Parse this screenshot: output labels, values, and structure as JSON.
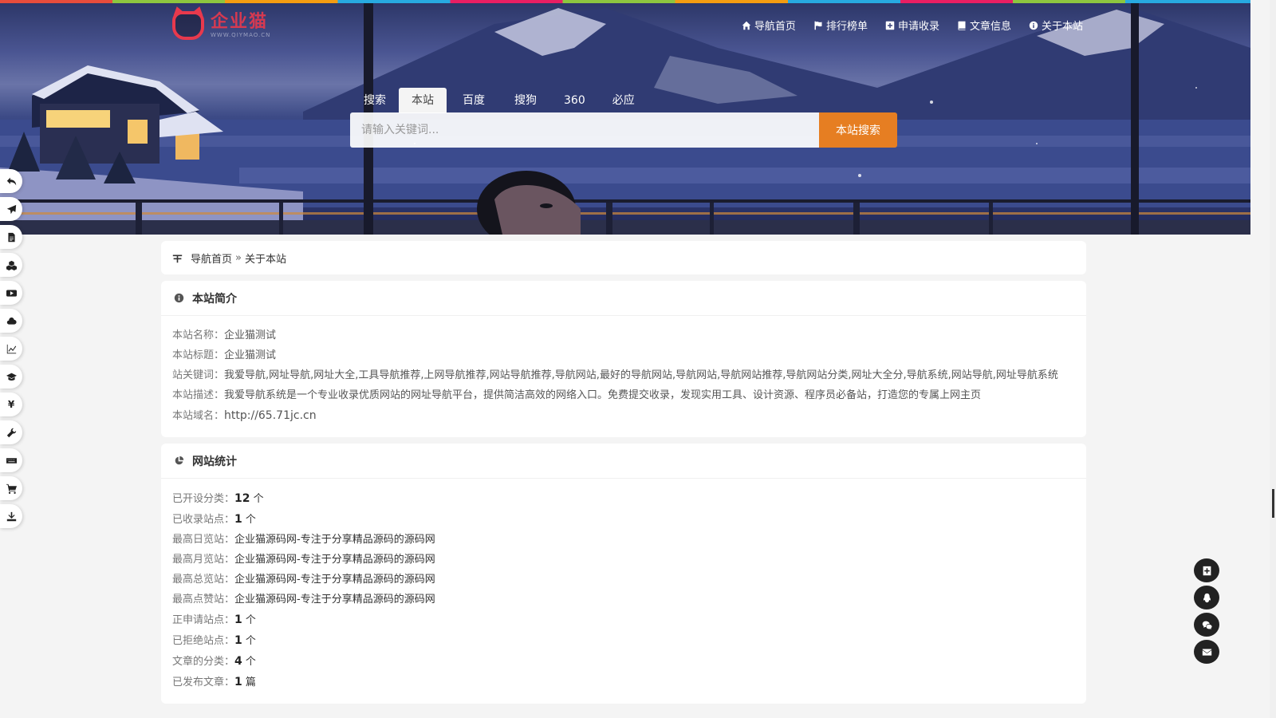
{
  "brand": {
    "logo_title": "企业猫",
    "logo_sub": "WWW.QIYMAO.CN"
  },
  "colors": {
    "accent": "#e67e22",
    "brand": "#e8394d"
  },
  "topnav": [
    {
      "icon": "home-icon",
      "label": "导航首页"
    },
    {
      "icon": "flag-icon",
      "label": "排行榜单"
    },
    {
      "icon": "plus-square-icon",
      "label": "申请收录"
    },
    {
      "icon": "book-icon",
      "label": "文章信息"
    },
    {
      "icon": "info-circle-icon",
      "label": "关于本站"
    }
  ],
  "search": {
    "tabs": [
      "搜索",
      "本站",
      "百度",
      "搜狗",
      "360",
      "必应"
    ],
    "active_tab": "本站",
    "placeholder": "请输入关键词...",
    "button": "本站搜索"
  },
  "leftbar": [
    {
      "icon": "undo-icon"
    },
    {
      "icon": "paper-plane-icon"
    },
    {
      "icon": "file-icon"
    },
    {
      "icon": "cubes-icon"
    },
    {
      "icon": "youtube-icon"
    },
    {
      "icon": "cloud-icon"
    },
    {
      "icon": "line-chart-icon"
    },
    {
      "icon": "graduation-cap-icon"
    },
    {
      "icon": "yen-icon",
      "glyph": "¥"
    },
    {
      "icon": "wrench-icon"
    },
    {
      "icon": "keyboard-icon"
    },
    {
      "icon": "cart-icon"
    },
    {
      "icon": "download-icon"
    }
  ],
  "breadcrumb": {
    "home": "导航首页",
    "sep": "»",
    "current": "关于本站"
  },
  "intro": {
    "title": "本站简介",
    "rows": [
      {
        "label": "本站名称：",
        "value": "企业猫测试"
      },
      {
        "label": "本站标题：",
        "value": "企业猫测试"
      },
      {
        "label": "站关键词：",
        "value": "我爱导航,网址导航,网址大全,工具导航推荐,上网导航推荐,网站导航推荐,导航网站,最好的导航网站,导航网站,导航网站推荐,导航网站分类,网址大全分,导航系统,网站导航,网址导航系统"
      },
      {
        "label": "本站描述：",
        "value": "我爱导航系统是一个专业收录优质网站的网址导航平台，提供简洁高效的网络入口。免费提交收录，发现实用工具、设计资源、程序员必备站，打造您的专属上网主页"
      },
      {
        "label": "本站域名：",
        "value": "http://65.71jc.cn"
      }
    ]
  },
  "stats": {
    "title": "网站统计",
    "rows": [
      {
        "label": "已开设分类：",
        "num": "12",
        "unit": " 个"
      },
      {
        "label": "已收录站点：",
        "num": "1",
        "unit": " 个"
      },
      {
        "label": "最高日览站：",
        "text": "企业猫源码网-专注于分享精品源码的源码网"
      },
      {
        "label": "最高月览站：",
        "text": "企业猫源码网-专注于分享精品源码的源码网"
      },
      {
        "label": "最高总览站：",
        "text": "企业猫源码网-专注于分享精品源码的源码网"
      },
      {
        "label": "最高点赞站：",
        "text": "企业猫源码网-专注于分享精品源码的源码网"
      },
      {
        "label": "正申请站点：",
        "num": "1",
        "unit": " 个"
      },
      {
        "label": "已拒绝站点：",
        "num": "1",
        "unit": " 个"
      },
      {
        "label": "文章的分类：",
        "num": "4",
        "unit": " 个"
      },
      {
        "label": "已发布文章：",
        "num": "1",
        "unit": " 篇"
      }
    ]
  },
  "rightbar": [
    {
      "icon": "plus-square-icon"
    },
    {
      "icon": "qq-icon"
    },
    {
      "icon": "wechat-icon"
    },
    {
      "icon": "envelope-icon"
    }
  ]
}
